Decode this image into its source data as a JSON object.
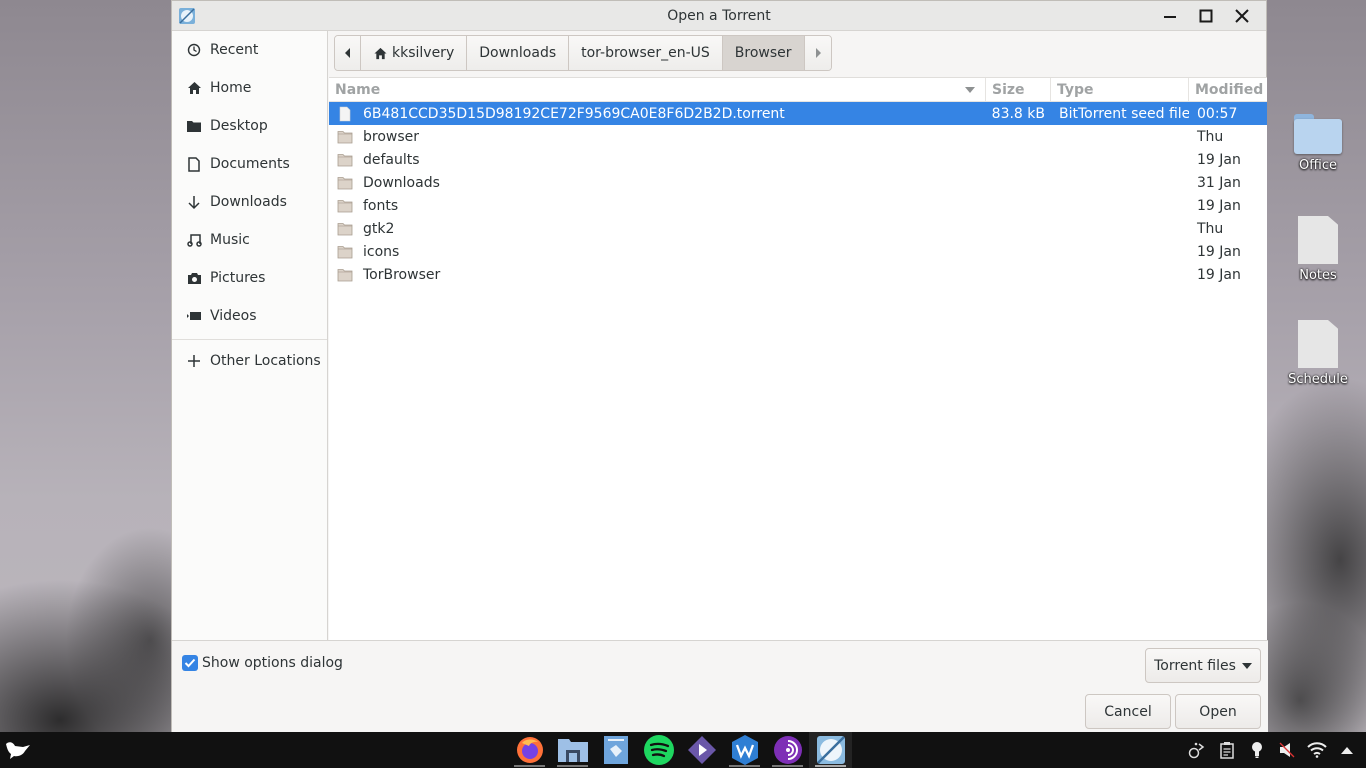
{
  "window": {
    "title": "Open a Torrent",
    "buttons": [
      "minimize",
      "maximize",
      "close"
    ]
  },
  "sidebar": {
    "items": [
      {
        "label": "Recent",
        "icon": "clock-icon"
      },
      {
        "label": "Home",
        "icon": "home-icon"
      },
      {
        "label": "Desktop",
        "icon": "folder-icon"
      },
      {
        "label": "Documents",
        "icon": "document-icon"
      },
      {
        "label": "Downloads",
        "icon": "download-arrow-icon"
      },
      {
        "label": "Music",
        "icon": "music-note-icon"
      },
      {
        "label": "Pictures",
        "icon": "camera-icon"
      },
      {
        "label": "Videos",
        "icon": "video-camera-icon"
      }
    ],
    "other_locations": {
      "label": "Other Locations",
      "icon": "plus-icon"
    }
  },
  "pathbar": {
    "segments": [
      {
        "label": "kksilvery",
        "icon": "home-icon"
      },
      {
        "label": "Downloads"
      },
      {
        "label": "tor-browser_en-US"
      },
      {
        "label": "Browser",
        "active": true
      }
    ]
  },
  "filelist": {
    "columns": {
      "name": "Name",
      "size": "Size",
      "type": "Type",
      "modified": "Modified"
    },
    "rows": [
      {
        "name": "6B481CCD35D15D98192CE72F9569CA0E8F6D2B2D.torrent",
        "size": "83.8 kB",
        "type": "BitTorrent seed file",
        "modified": "00:57",
        "kind": "file",
        "selected": true
      },
      {
        "name": "browser",
        "size": "",
        "type": "",
        "modified": "Thu",
        "kind": "folder"
      },
      {
        "name": "defaults",
        "size": "",
        "type": "",
        "modified": "19 Jan",
        "kind": "folder"
      },
      {
        "name": "Downloads",
        "size": "",
        "type": "",
        "modified": "31 Jan",
        "kind": "folder"
      },
      {
        "name": "fonts",
        "size": "",
        "type": "",
        "modified": "19 Jan",
        "kind": "folder"
      },
      {
        "name": "gtk2",
        "size": "",
        "type": "",
        "modified": "Thu",
        "kind": "folder"
      },
      {
        "name": "icons",
        "size": "",
        "type": "",
        "modified": "19 Jan",
        "kind": "folder"
      },
      {
        "name": "TorBrowser",
        "size": "",
        "type": "",
        "modified": "19 Jan",
        "kind": "folder"
      }
    ]
  },
  "footer": {
    "show_options_label": "Show options dialog",
    "show_options_checked": true,
    "filter_label": "Torrent files",
    "cancel_label": "Cancel",
    "open_label": "Open"
  },
  "desktop": {
    "icons": [
      {
        "label": "Office",
        "kind": "folder"
      },
      {
        "label": "Notes",
        "kind": "document"
      },
      {
        "label": "Schedule",
        "kind": "document"
      }
    ]
  },
  "taskbar": {
    "apps": [
      {
        "name": "firefox",
        "icon": "firefox-icon"
      },
      {
        "name": "files",
        "icon": "file-manager-icon"
      },
      {
        "name": "notes",
        "icon": "notes-app-icon"
      },
      {
        "name": "spotify",
        "icon": "spotify-icon"
      },
      {
        "name": "media-player",
        "icon": "play-icon"
      },
      {
        "name": "wps-office",
        "icon": "wps-office-icon"
      },
      {
        "name": "tor-browser",
        "icon": "tor-browser-icon"
      },
      {
        "name": "transmission",
        "icon": "transmission-icon"
      }
    ],
    "tray": [
      "network-vpn-icon",
      "clipboard-icon",
      "lightbulb-icon",
      "volume-muted-icon",
      "wifi-icon",
      "tray-expand-icon"
    ]
  },
  "colors": {
    "accent": "#3584e4",
    "selection_text": "#ffffff",
    "taskbar": "#111111"
  }
}
